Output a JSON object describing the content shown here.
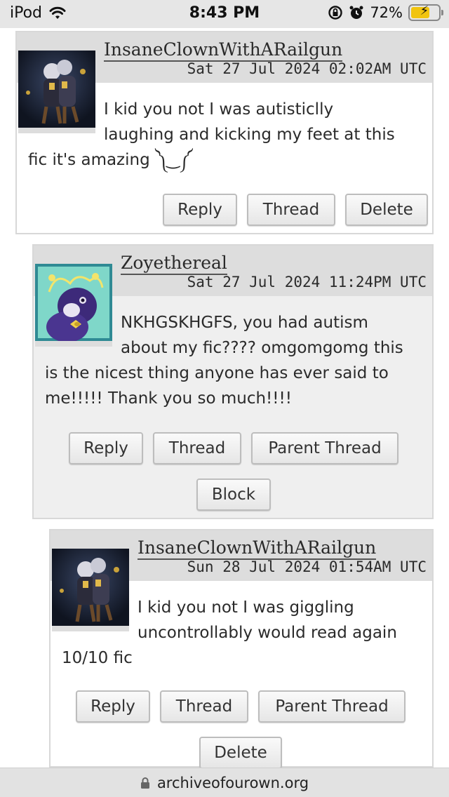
{
  "status_bar": {
    "device": "iPod",
    "time": "8:43 PM",
    "battery": "72%",
    "battery_level": 0.72,
    "wifi_icon": "wifi-icon",
    "lock_icon": "orientation-lock-icon",
    "alarm_icon": "alarm-icon"
  },
  "comments": [
    {
      "username": "InsaneClownWithARailgun",
      "datetime": "Sat 27 Jul 2024 02:02AM UTC",
      "text_line1": "I kid you not I was autisticlly",
      "text_line2": "laughing and kicking my feet at this",
      "text_line3": "fic it's amazing ༽‿༼",
      "buttons": {
        "reply": "Reply",
        "thread": "Thread",
        "delete": "Delete"
      }
    },
    {
      "username": "Zoyethereal",
      "datetime": "Sat 27 Jul 2024 11:24PM UTC",
      "text_line1": "NKHGSKHGFS, you had autism",
      "text_line2": "about my fic???? omgomgomg this",
      "text_line3": "is the nicest thing anyone has ever said to",
      "text_line4": "me!!!!! Thank you so much!!!!",
      "buttons": {
        "reply": "Reply",
        "thread": "Thread",
        "parent": "Parent Thread",
        "block": "Block"
      }
    },
    {
      "username": "InsaneClownWithARailgun",
      "datetime": "Sun 28 Jul 2024 01:54AM UTC",
      "text_line1": "I kid you not I was giggling",
      "text_line2": "uncontrollably would read again",
      "text_line3": "10/10 fic",
      "buttons": {
        "reply": "Reply",
        "thread": "Thread",
        "parent": "Parent Thread",
        "delete": "Delete"
      }
    }
  ],
  "url_bar": {
    "url": "archiveofourown.org",
    "icon": "lock-icon"
  },
  "colors": {
    "byline_bg": "#dddddd",
    "thread_bg": "#efefef",
    "button_border": "#bdbdbd",
    "battery_fill": "#f1c40f"
  }
}
